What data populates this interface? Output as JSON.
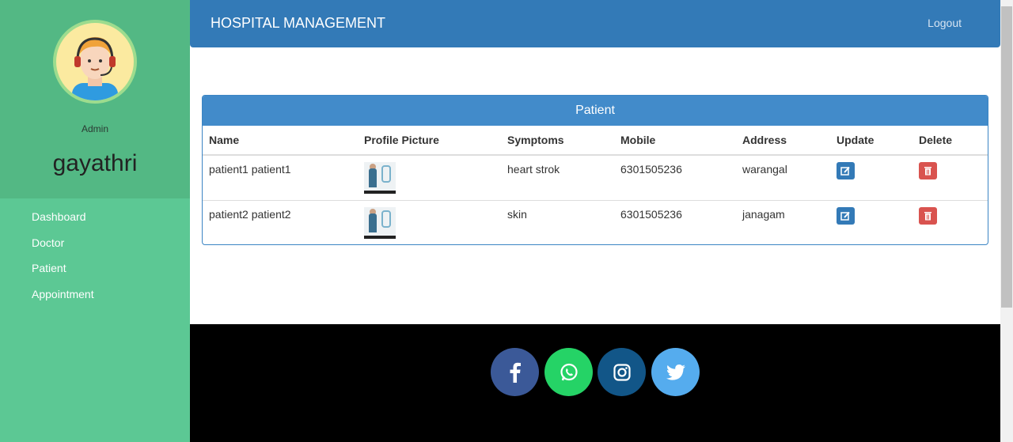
{
  "sidebar": {
    "role": "Admin",
    "username": "gayathri",
    "items": [
      {
        "label": "Dashboard"
      },
      {
        "label": "Doctor"
      },
      {
        "label": "Patient"
      },
      {
        "label": "Appointment"
      }
    ]
  },
  "header": {
    "title": "HOSPITAL MANAGEMENT",
    "logout": "Logout"
  },
  "panel": {
    "title": "Patient",
    "columns": [
      "Name",
      "Profile Picture",
      "Symptoms",
      "Mobile",
      "Address",
      "Update",
      "Delete"
    ],
    "rows": [
      {
        "name": "patient1 patient1",
        "symptoms": "heart strok",
        "mobile": "6301505236",
        "address": "warangal"
      },
      {
        "name": "patient2 patient2",
        "symptoms": "skin",
        "mobile": "6301505236",
        "address": "janagam"
      }
    ]
  },
  "footer": {
    "social": [
      {
        "icon": "facebook-icon",
        "color": "#3b5998"
      },
      {
        "icon": "whatsapp-icon",
        "color": "#25d366"
      },
      {
        "icon": "instagram-icon",
        "color": "#125688"
      },
      {
        "icon": "twitter-icon",
        "color": "#55acee"
      }
    ]
  },
  "colors": {
    "sidebar": "#5cc894",
    "profile_bg": "#53b884",
    "topbar": "#337ab7",
    "panel_head": "#428bca",
    "edit_button": "#337ab7",
    "delete_button": "#d9534f"
  }
}
